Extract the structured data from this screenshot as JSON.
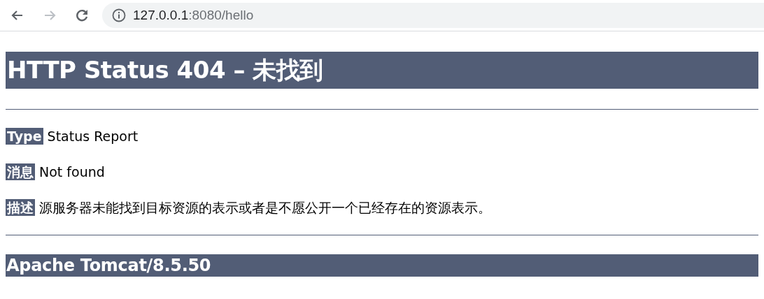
{
  "toolbar": {
    "nav_buttons": [
      {
        "kind": "back",
        "disabled": false
      },
      {
        "kind": "forward",
        "disabled": true
      },
      {
        "kind": "reload",
        "disabled": false
      }
    ],
    "address": {
      "host": "127.0.0.1",
      "path": ":8080/hello"
    }
  },
  "page": {
    "title": "HTTP Status 404 – 未找到",
    "fields": [
      {
        "label": "Type",
        "value": "Status Report"
      },
      {
        "label": "消息",
        "value": "Not found"
      },
      {
        "label": "描述",
        "value": "源服务器未能找到目标资源的表示或者是不愿公开一个已经存在的资源表示。"
      }
    ],
    "footer": "Apache Tomcat/8.5.50"
  }
}
